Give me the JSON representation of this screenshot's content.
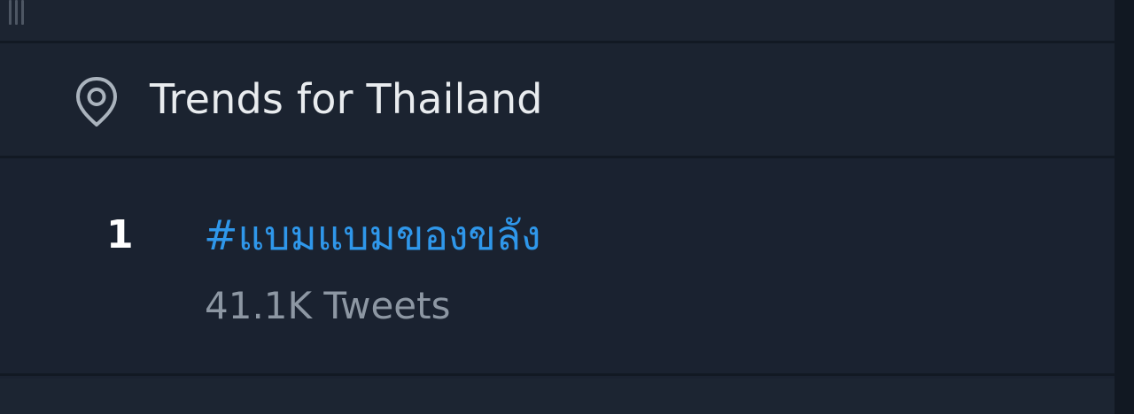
{
  "trends_panel": {
    "header": {
      "icon": "location-pin-icon",
      "title": "Trends for Thailand"
    },
    "trends": [
      {
        "rank": "1",
        "hashtag": "#แบมแบมของขลัง",
        "tweet_count": "41.1K Tweets"
      }
    ]
  },
  "colors": {
    "background": "#1a2230",
    "divider": "#121923",
    "title_text": "#e9ecef",
    "hashtag_link": "#2f97ea",
    "secondary_text": "#8d97a3",
    "rank_text": "#ffffff"
  }
}
